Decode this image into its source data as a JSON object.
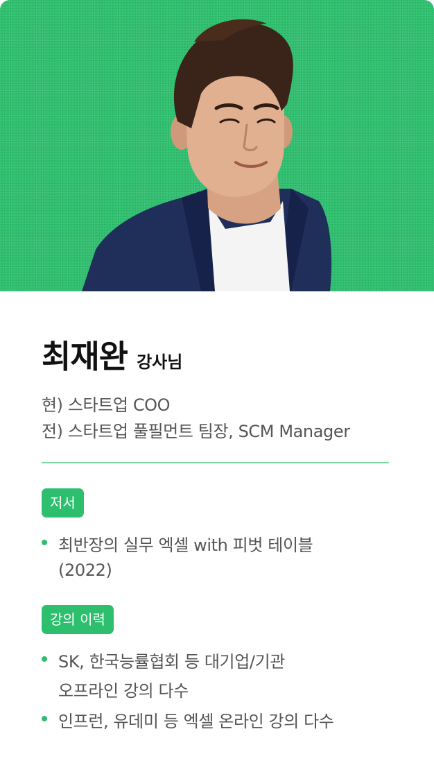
{
  "instructor": {
    "name": "최재완",
    "honorific": "강사님",
    "positions": [
      "현) 스타트업 COO",
      "전) 스타트업 풀필먼트 팀장, SCM Manager"
    ]
  },
  "sections": {
    "books": {
      "label": "저서",
      "items": [
        {
          "lines": [
            "최반장의 실무 엑셀 with 피벗 테이블",
            "(2022)"
          ]
        }
      ]
    },
    "career": {
      "label": "강의 이력",
      "items": [
        {
          "lines": [
            "SK, 한국능률협회 등 대기업/기관",
            "오프라인 강의 다수"
          ]
        },
        {
          "lines": [
            "인프런, 유데미 등 엑셀 온라인 강의 다수"
          ]
        }
      ]
    }
  },
  "colors": {
    "accent": "#2dbf6e",
    "divider": "#7ed9a6",
    "text_dark": "#111111",
    "text_body": "#555555",
    "jacket": "#1f2f5a"
  },
  "icons": [
    "bullet-dot"
  ]
}
